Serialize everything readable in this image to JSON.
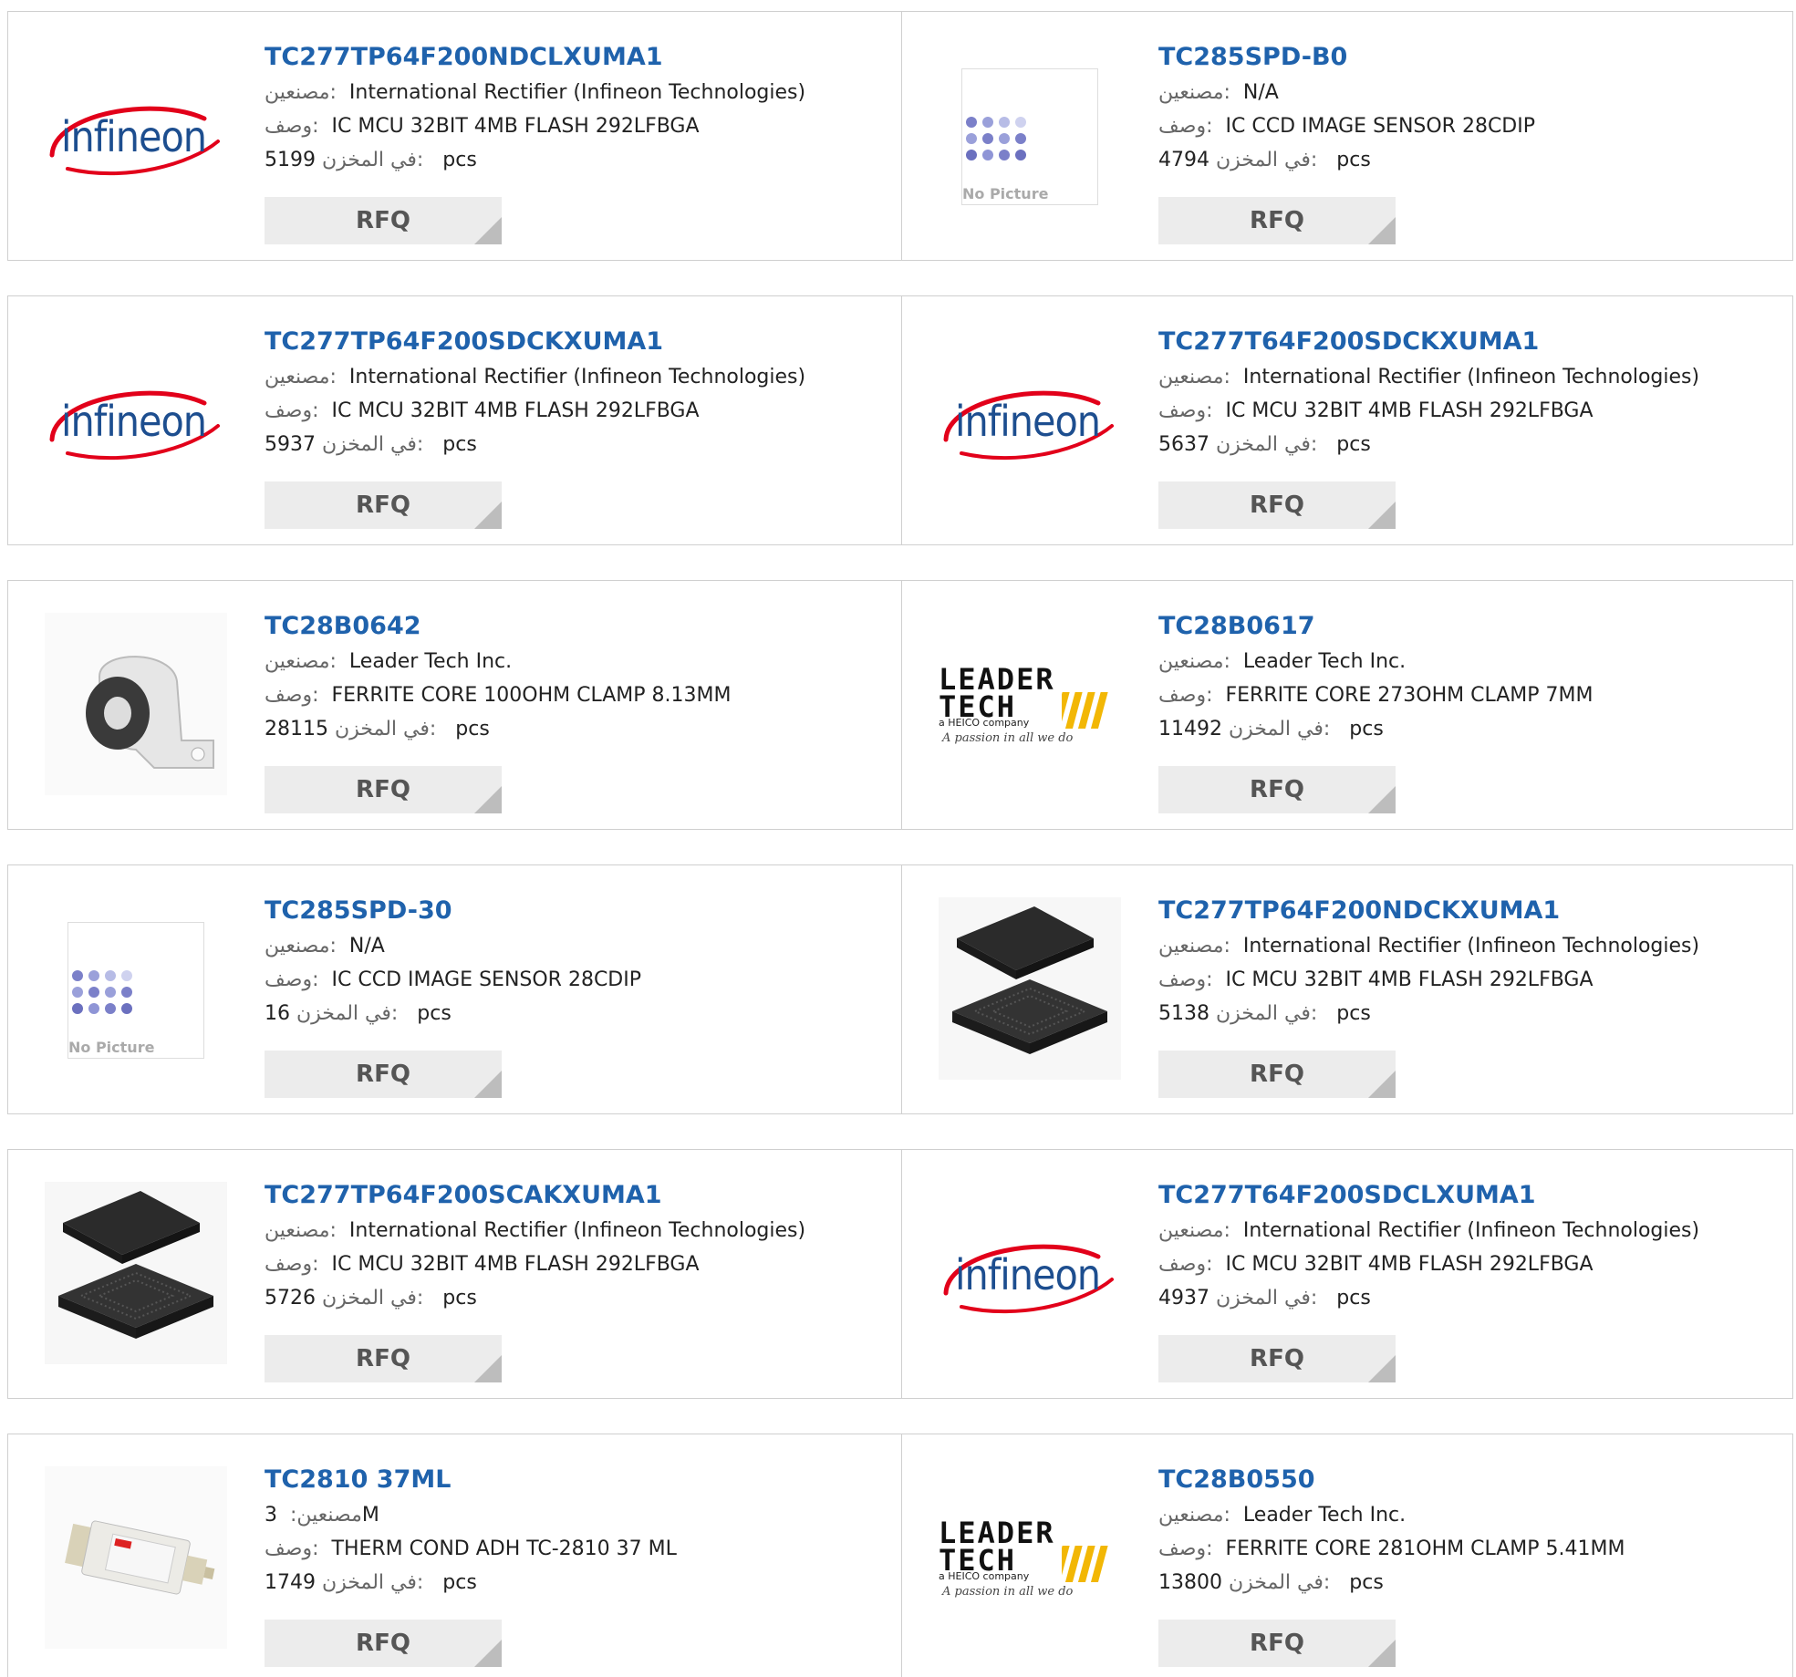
{
  "labels": {
    "manufacturer": "مصنعين:",
    "description": "وصف:",
    "stock": "في المخزن:",
    "unit": "pcs",
    "rfq": "RFQ"
  },
  "products": [
    {
      "pn": "TC277TP64F200NDCLXUMA1",
      "mfr": "International Rectifier (Infineon Technologies)",
      "desc": "IC MCU 32BIT 4MB FLASH 292LFBGA",
      "stock": "5199",
      "img": "infineon"
    },
    {
      "pn": "TC285SPD-B0",
      "mfr": "N/A",
      "desc": "IC CCD IMAGE SENSOR 28CDIP",
      "stock": "4794",
      "img": "no-picture",
      "img_text": "No Picture"
    },
    {
      "pn": "TC277TP64F200SDCKXUMA1",
      "mfr": "International Rectifier (Infineon Technologies)",
      "desc": "IC MCU 32BIT 4MB FLASH 292LFBGA",
      "stock": "5937",
      "img": "infineon"
    },
    {
      "pn": "TC277T64F200SDCKXUMA1",
      "mfr": "International Rectifier (Infineon Technologies)",
      "desc": "IC MCU 32BIT 4MB FLASH 292LFBGA",
      "stock": "5637",
      "img": "infineon"
    },
    {
      "pn": "TC28B0642",
      "mfr": "Leader Tech Inc.",
      "desc": "FERRITE CORE 100OHM CLAMP 8.13MM",
      "stock": "28115",
      "img": "ferrite-clamp"
    },
    {
      "pn": "TC28B0617",
      "mfr": "Leader Tech Inc.",
      "desc": "FERRITE CORE 273OHM CLAMP 7MM",
      "stock": "11492",
      "img": "leader-tech"
    },
    {
      "pn": "TC285SPD-30",
      "mfr": "N/A",
      "desc": "IC CCD IMAGE SENSOR 28CDIP",
      "stock": "16",
      "img": "no-picture",
      "img_text": "No Picture"
    },
    {
      "pn": "TC277TP64F200NDCKXUMA1",
      "mfr": "International Rectifier (Infineon Technologies)",
      "desc": "IC MCU 32BIT 4MB FLASH 292LFBGA",
      "stock": "5138",
      "img": "bga-chip"
    },
    {
      "pn": "TC277TP64F200SCAKXUMA1",
      "mfr": "International Rectifier (Infineon Technologies)",
      "desc": "IC MCU 32BIT 4MB FLASH 292LFBGA",
      "stock": "5726",
      "img": "bga-chip"
    },
    {
      "pn": "TC277T64F200SDCLXUMA1",
      "mfr": "International Rectifier (Infineon Technologies)",
      "desc": "IC MCU 32BIT 4MB FLASH 292LFBGA",
      "stock": "4937",
      "img": "infineon"
    },
    {
      "pn": "TC2810 37ML",
      "mfr": "3M",
      "desc": "THERM COND ADH TC-2810 37 ML",
      "stock": "1749",
      "img": "adhesive-tube"
    },
    {
      "pn": "TC28B0550",
      "mfr": "Leader Tech Inc.",
      "desc": "FERRITE CORE 281OHM CLAMP 5.41MM",
      "stock": "13800",
      "img": "leader-tech"
    }
  ],
  "logos": {
    "infineon": "infineon",
    "leader_tech": [
      "LEADER",
      "TECH",
      "a HEICO company",
      "A passion in all we do"
    ]
  },
  "colors": {
    "link": "#1f62ac",
    "border": "#cfcfcf",
    "button_bg": "#ececec",
    "infineon_red": "#e2001a",
    "infineon_blue": "#1d4e8f"
  }
}
